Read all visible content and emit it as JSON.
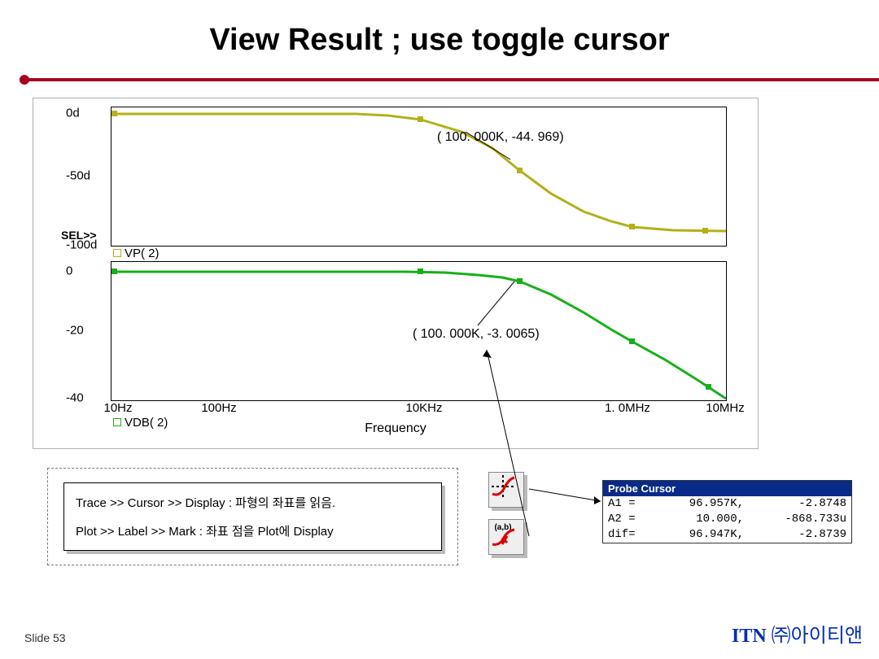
{
  "title": "View Result ; use toggle cursor",
  "chart_data": [
    {
      "type": "line",
      "series_name": "VP( 2)",
      "color": "#b3b019",
      "xscale": "log",
      "x_ticks": [
        "10Hz",
        "100Hz",
        "10KHz",
        "1.0MHz",
        "10MHz"
      ],
      "ylabel": "",
      "y_ticks": [
        0,
        -50,
        -100
      ],
      "y_tick_labels": [
        "0d",
        "-50d",
        "-100d"
      ],
      "ylim": [
        -100,
        6
      ],
      "sel_marker": "SEL>>",
      "cursor_annotation": "( 100. 000K, -44. 969)",
      "points": [
        {
          "x": 10,
          "y": 0
        },
        {
          "x": 50,
          "y": 0
        },
        {
          "x": 100,
          "y": 0
        },
        {
          "x": 500,
          "y": 0
        },
        {
          "x": 1000,
          "y": 0
        },
        {
          "x": 5000,
          "y": -2
        },
        {
          "x": 10000,
          "y": -5
        },
        {
          "x": 30000,
          "y": -15
        },
        {
          "x": 70000,
          "y": -35
        },
        {
          "x": 100000,
          "y": -44.969
        },
        {
          "x": 200000,
          "y": -63
        },
        {
          "x": 400000,
          "y": -78
        },
        {
          "x": 700000,
          "y": -85
        },
        {
          "x": 1000000,
          "y": -88
        },
        {
          "x": 3000000,
          "y": -90
        },
        {
          "x": 10000000,
          "y": -90
        }
      ]
    },
    {
      "type": "line",
      "series_name": "VDB( 2)",
      "color": "#17b019",
      "xscale": "log",
      "x_ticks": [
        "10Hz",
        "100Hz",
        "10KHz",
        "1.0MHz",
        "10MHz"
      ],
      "ylabel": "",
      "y_ticks": [
        0,
        -20,
        -40
      ],
      "ylim": [
        -40,
        4
      ],
      "cursor_annotation": "( 100. 000K, -3. 0065)",
      "points": [
        {
          "x": 10,
          "y": 0
        },
        {
          "x": 100,
          "y": 0
        },
        {
          "x": 1000,
          "y": 0
        },
        {
          "x": 5000,
          "y": -0.05
        },
        {
          "x": 10000,
          "y": -0.1
        },
        {
          "x": 30000,
          "y": -0.5
        },
        {
          "x": 60000,
          "y": -1.5
        },
        {
          "x": 100000,
          "y": -3.0065
        },
        {
          "x": 200000,
          "y": -7
        },
        {
          "x": 400000,
          "y": -12.5
        },
        {
          "x": 700000,
          "y": -17
        },
        {
          "x": 1000000,
          "y": -20
        },
        {
          "x": 2000000,
          "y": -26
        },
        {
          "x": 5000000,
          "y": -34
        },
        {
          "x": 10000000,
          "y": -40
        }
      ]
    }
  ],
  "xaxis_label": "Frequency",
  "legends": {
    "top": "VP( 2)",
    "bottom": "VDB( 2)"
  },
  "yticks1": {
    "t0": "0d",
    "t1": "-50d",
    "t2": "-100d"
  },
  "yticks2": {
    "t0": "0",
    "t1": "-20",
    "t2": "-40"
  },
  "xticks": {
    "x0": "10Hz",
    "x1": "100Hz",
    "x2": "10KHz",
    "x3": "1. 0MHz",
    "x4": "10MHz"
  },
  "sel": "SEL>>",
  "ann1": "( 100. 000K, -44. 969)",
  "ann2": "( 100. 000K, -3. 0065)",
  "instructions": {
    "line1": "Trace >> Cursor >> Display : 파형의 좌표를 읽음.",
    "line2": "Plot >> Label >> Mark : 좌표 점을 Plot에 Display"
  },
  "icon2_label": "(a,b)",
  "probe": {
    "title": "Probe Cursor",
    "rows": {
      "r0": {
        "c1": "A1 =",
        "c2": "96.957K,",
        "c3": "-2.8748"
      },
      "r1": {
        "c1": "A2 =",
        "c2": "10.000,",
        "c3": "-868.733u"
      },
      "r2": {
        "c1": "dif=",
        "c2": "96.947K,",
        "c3": "-2.8739"
      }
    }
  },
  "footer": {
    "slide": "Slide 53",
    "brand_en": "ITN ",
    "brand_kr": "㈜아이티앤"
  }
}
